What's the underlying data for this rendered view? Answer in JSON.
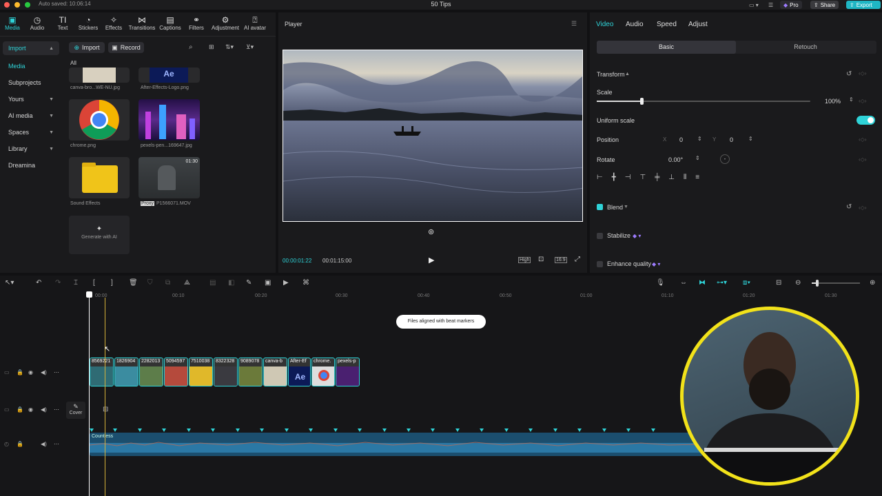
{
  "titlebar": {
    "autosave": "Auto saved: 10:06:14",
    "title": "50 Tips",
    "pro": "Pro",
    "share": "Share",
    "export": "Export"
  },
  "toolbar": {
    "items": [
      "Media",
      "Audio",
      "Text",
      "Stickers",
      "Effects",
      "Transitions",
      "Captions",
      "Filters",
      "Adjustment",
      "AI avatar"
    ]
  },
  "sidebar": {
    "items": [
      "Import",
      "Media",
      "Subprojects",
      "Yours",
      "AI media",
      "Spaces",
      "Library",
      "Dreamina"
    ]
  },
  "media": {
    "import_btn": "Import",
    "record_btn": "Record",
    "filter_label": "All",
    "files": [
      {
        "name": "canva-bro...WE-NU.jpg"
      },
      {
        "name": "After-Effects-Logo.png",
        "text": "Ae"
      },
      {
        "name": "chrome.png"
      },
      {
        "name": "pexels-pen...169647.jpg"
      },
      {
        "name": "Sound Effects"
      },
      {
        "name": "P1566071.MOV",
        "badge": "Proxy",
        "duration": "01:30"
      }
    ],
    "generate": "Generate with AI"
  },
  "player": {
    "title": "Player",
    "current": "00:00:01:22",
    "total": "00:01:15:00",
    "quality": "High",
    "ratio": "16:9"
  },
  "inspector": {
    "tabs": [
      "Video",
      "Audio",
      "Speed",
      "Adjust"
    ],
    "subtabs": [
      "Basic",
      "Retouch"
    ],
    "transform": "Transform",
    "scale_label": "Scale",
    "scale_value": "100%",
    "scale_fraction": 0.02,
    "uniform_label": "Uniform scale",
    "position_label": "Position",
    "x_label": "X",
    "x_value": "0",
    "y_label": "Y",
    "y_value": "0",
    "rotate_label": "Rotate",
    "rotate_value": "0.00°",
    "blend": "Blend",
    "stabilize": "Stabilize",
    "enhance": "Enhance quality"
  },
  "timeline": {
    "ruler": [
      "00:00",
      "00:10",
      "00:20",
      "00:30",
      "00:40",
      "00:50",
      "01:00",
      "01:10",
      "01:20",
      "01:30"
    ],
    "toast": "Files aligned with beat markers",
    "clips": [
      "8569221",
      "1826904",
      "2282013",
      "5094597",
      "7510038",
      "8322328",
      "9089078",
      "canva-b",
      "After-Ef",
      "chrome.",
      "pexels-p"
    ],
    "cover": "Cover",
    "audio_name": "Countless"
  },
  "colors": {
    "accent": "#2fd3d8",
    "export": "#1fb6c4",
    "playhead": "#d9b43a",
    "webcam_ring": "#f2e21a"
  }
}
